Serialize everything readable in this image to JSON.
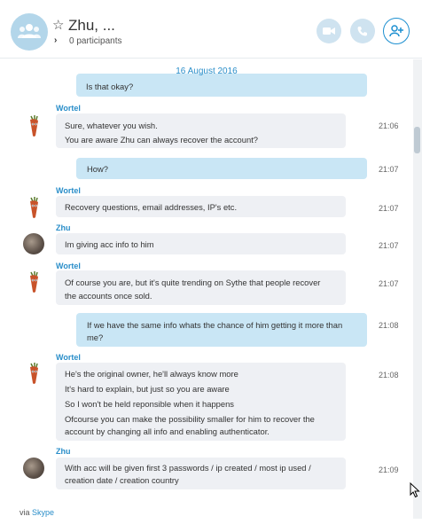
{
  "header": {
    "title": "Zhu, ...",
    "participants": "0 participants",
    "video_icon": "video-call-icon",
    "call_icon": "phone-call-icon",
    "add_icon": "add-person-icon"
  },
  "conversation": {
    "date": "16 August 2016",
    "partial_top_text": "Is that okay?",
    "blocks": [
      {
        "sender": "Wortel",
        "lines": [
          "Sure, whatever you wish.",
          "You are aware Zhu can always recover the account?"
        ],
        "time": "21:06"
      },
      {
        "sender": "",
        "lines": [
          "How?"
        ],
        "time": "21:07",
        "outgoing": true
      },
      {
        "sender": "Wortel",
        "lines": [
          "Recovery questions, email addresses, IP's etc."
        ],
        "time": "21:07"
      },
      {
        "sender": "Zhu",
        "lines": [
          "Im giving acc info to him"
        ],
        "time": "21:07"
      },
      {
        "sender": "Wortel",
        "lines": [
          "Of course you are, but it's quite trending on Sythe that people recover",
          "the accounts once sold."
        ],
        "time": "21:07"
      },
      {
        "sender": "",
        "lines": [
          "If we have the same info whats the chance of him getting it more than",
          "me?"
        ],
        "time": "21:08",
        "outgoing": true
      },
      {
        "sender": "Wortel",
        "lines": [
          "He's the original owner, he'll always know more",
          "It's hard to explain, but just so you are aware",
          "So I won't be held reponsible when it happens",
          "Ofcourse you can make the possibility smaller for him to recover the",
          "account by changing all info and enabling authenticator."
        ],
        "time": "21:08"
      },
      {
        "sender": "Zhu",
        "lines": [
          "With acc will be given first 3 passwords / ip created / most ip used /",
          "creation date / creation country"
        ],
        "time": "21:09"
      }
    ]
  },
  "footer": {
    "via_prefix": "via",
    "via_link": "Skype"
  }
}
